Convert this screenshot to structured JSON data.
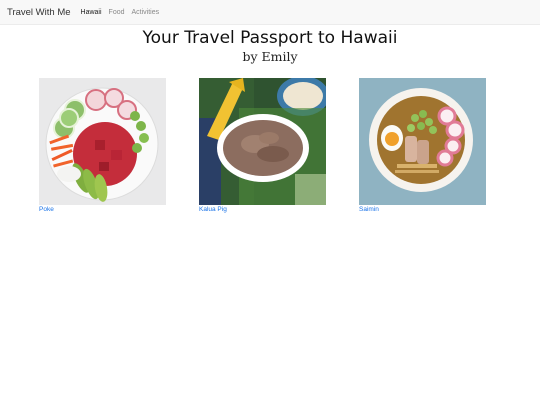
{
  "navbar": {
    "brand": "Travel With Me",
    "links": [
      "Hawaii",
      "Food",
      "Activities"
    ]
  },
  "header": {
    "title": "Your Travel Passport to Hawaii",
    "byline": "by Emily"
  },
  "gallery": [
    {
      "label": "Poke",
      "image_icon": "poke-bowl-photo"
    },
    {
      "label": "Kalua Pig",
      "image_icon": "kalua-pig-photo"
    },
    {
      "label": "Saimin",
      "image_icon": "saimin-photo"
    }
  ],
  "colors": {
    "link": "#1a73e8",
    "navbar_bg": "#f8f8f8"
  }
}
